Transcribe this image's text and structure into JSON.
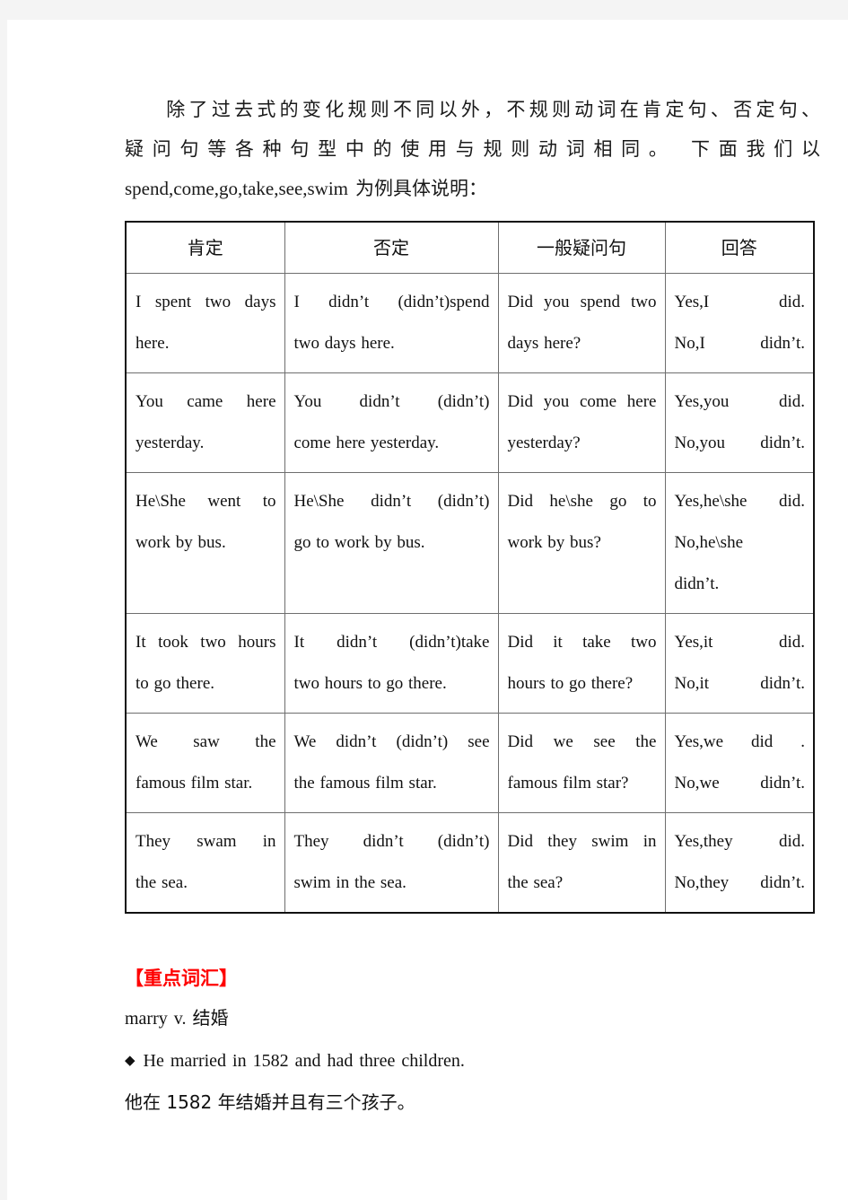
{
  "intro": {
    "line1": "除了过去式的变化规则不同以外，不规则动词在肯定句、否定句、",
    "line2": "疑问句等各种句型中的使用与规则动词相同。 下面我们以",
    "line3_en": "spend,come,go,take,see,swim",
    "line3_cn": "为例具体说明："
  },
  "table": {
    "headers": [
      "肯定",
      "否定",
      "一般疑问句",
      "回答"
    ],
    "rows": [
      {
        "affirmative": [
          "I spent two days",
          "here."
        ],
        "negative": [
          "I didn’t (didn’t)spend",
          "two days here."
        ],
        "question": [
          "Did you spend two",
          "days here?"
        ],
        "answer": [
          "Yes,I did.",
          "No,I didn’t."
        ]
      },
      {
        "affirmative": [
          "You came here",
          "yesterday."
        ],
        "negative": [
          "You didn’t (didn’t)",
          "come here yesterday."
        ],
        "question": [
          "Did you come here",
          "yesterday?"
        ],
        "answer": [
          "Yes,you did.",
          "No,you didn’t."
        ]
      },
      {
        "affirmative": [
          "He\\She went to",
          "work by bus."
        ],
        "negative": [
          "He\\She didn’t (didn’t)",
          "go to work by bus."
        ],
        "question": [
          "Did he\\she go to",
          "work by bus?"
        ],
        "answer": [
          "Yes,he\\she did.",
          "No,he\\she",
          "didn’t."
        ]
      },
      {
        "affirmative": [
          "It took two hours",
          "to go there."
        ],
        "negative": [
          "It didn’t (didn’t)take",
          "two hours to go there."
        ],
        "question": [
          "Did it take two",
          "hours to go there?"
        ],
        "answer": [
          "Yes,it did.",
          "No,it didn’t."
        ]
      },
      {
        "affirmative": [
          "We saw the",
          "famous film star."
        ],
        "negative": [
          "We didn’t (didn’t) see",
          "the famous film star."
        ],
        "question": [
          "Did we see the",
          "famous film star?"
        ],
        "answer": [
          "Yes,we did .",
          "No,we didn’t."
        ]
      },
      {
        "affirmative": [
          "They swam in",
          "the sea."
        ],
        "negative": [
          "They didn’t (didn’t)",
          "swim in the sea."
        ],
        "question": [
          "Did they swim in",
          "the sea?"
        ],
        "answer": [
          "Yes,they did.",
          "No,they didn’t."
        ]
      }
    ]
  },
  "vocab": {
    "heading": "【重点词汇】",
    "entry": "marry v.  结婚",
    "bullet_glyph": "◆",
    "example_en": "He married in 1582 and had three children.",
    "example_cn": "他在 1582 年结婚并且有三个孩子。"
  },
  "colors": {
    "heading_red": "#ff0000",
    "text": "#111111",
    "border": "#6e6e6e",
    "page_bg": "#ffffff",
    "canvas_bg": "#f4f4f4"
  }
}
